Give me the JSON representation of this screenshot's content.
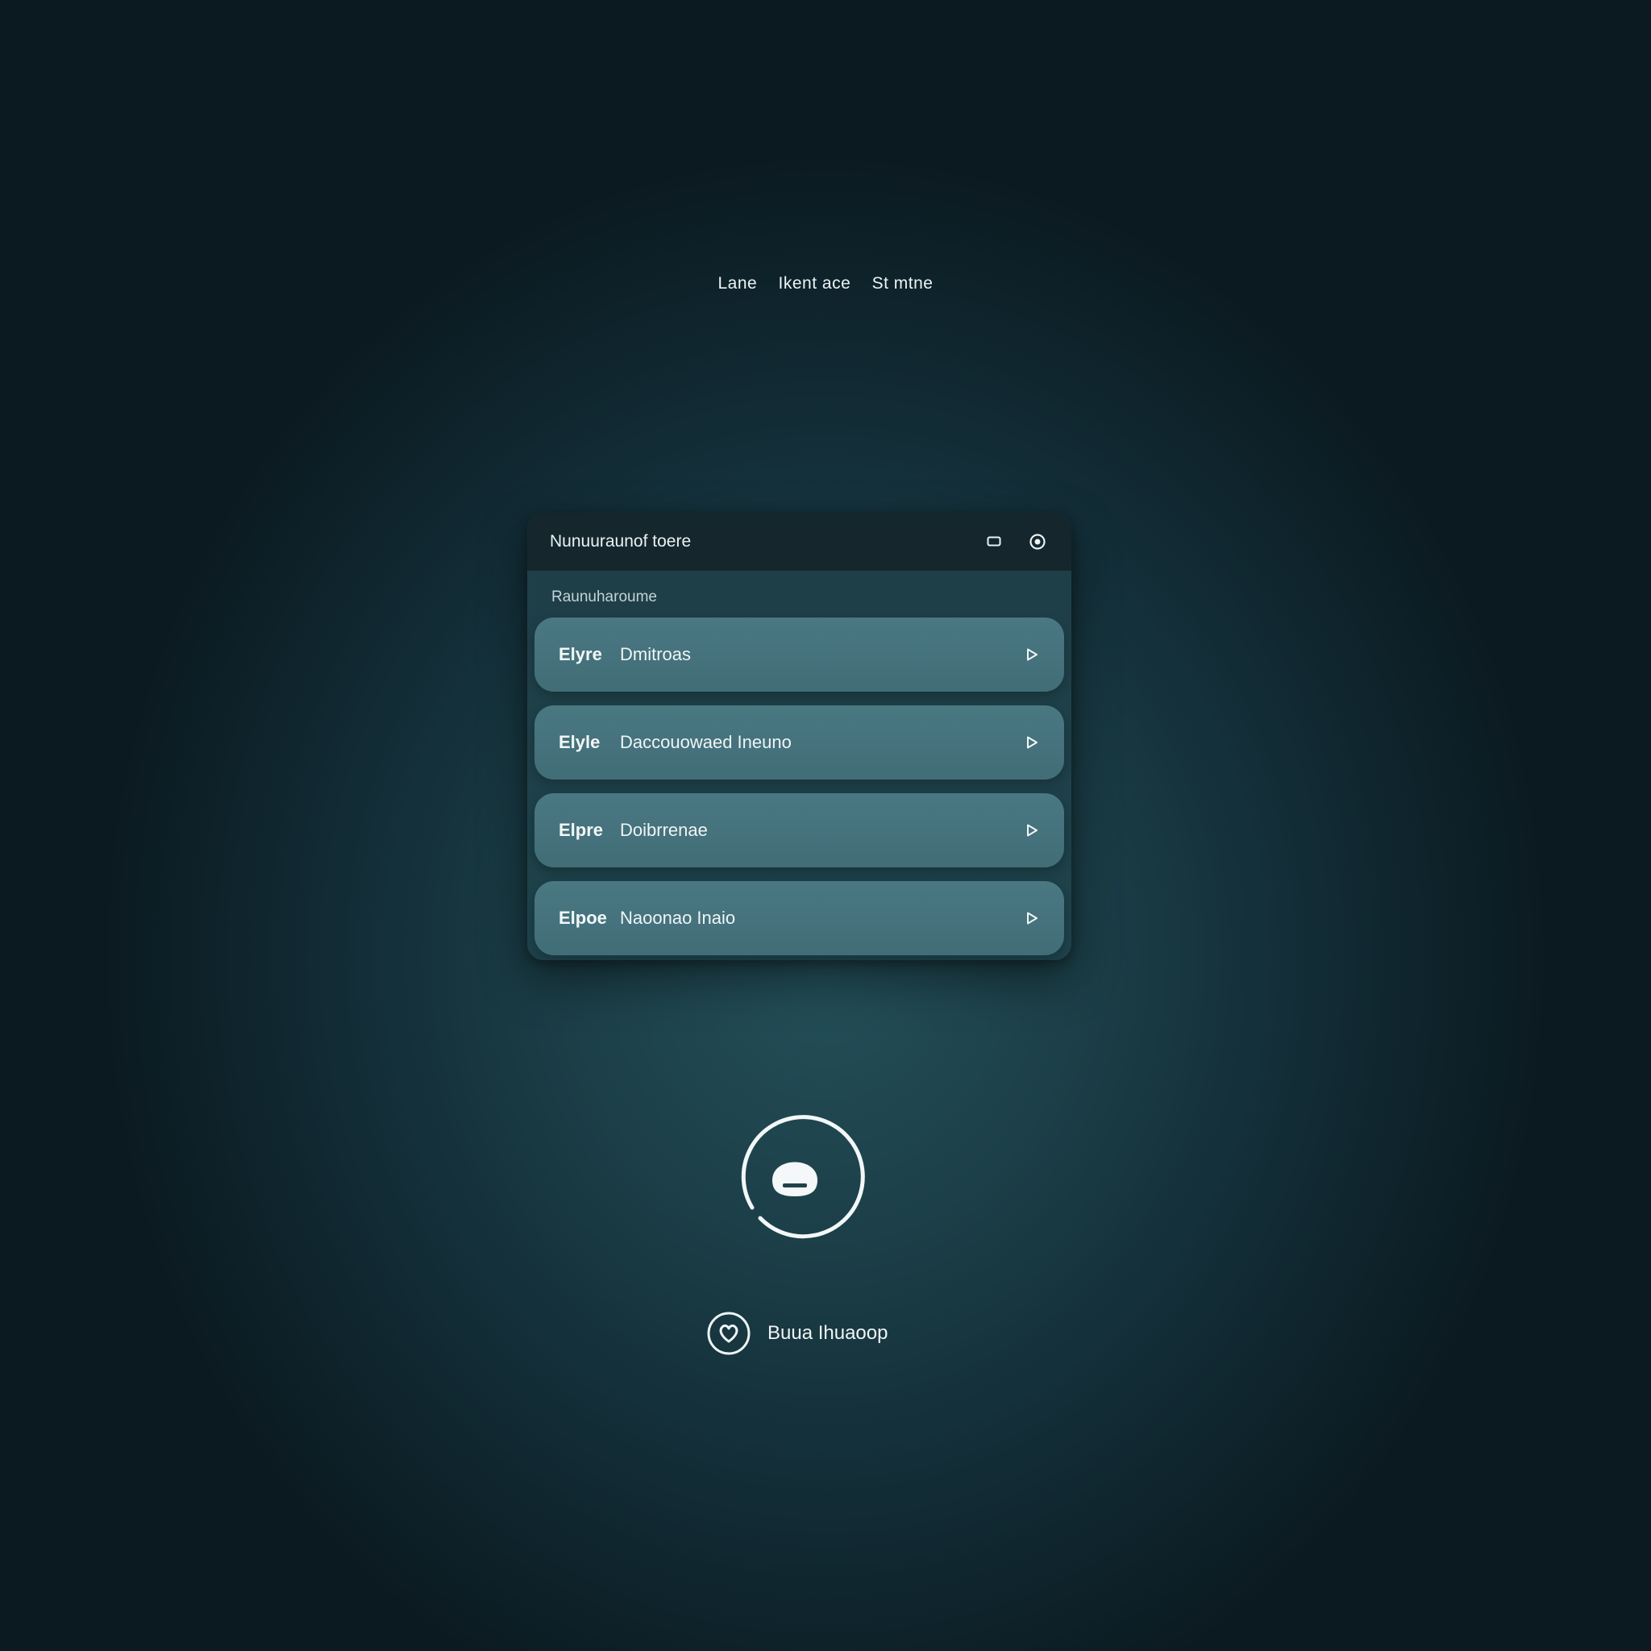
{
  "header": {
    "caption_parts": [
      "Lane",
      "Ikent ace",
      "St mtne"
    ]
  },
  "panel": {
    "title": "Nunuuraunof toere",
    "minimize_icon": "window-minimize-icon",
    "settings_icon": "settings-circle-icon",
    "section_label": "Raunuharoume",
    "items": [
      {
        "tag": "Elyre",
        "label": "Dmitroas",
        "icon": "play-arrow-icon"
      },
      {
        "tag": "Elyle",
        "label": "Daccouowaed Ineuno",
        "icon": "play-arrow-icon"
      },
      {
        "tag": "Elpre",
        "label": "Doibrrenae",
        "icon": "play-arrow-icon"
      },
      {
        "tag": "Elpoe",
        "label": "Naoonao Inaio",
        "icon": "play-arrow-icon"
      }
    ]
  },
  "record_button": {
    "icon": "microphone-record-icon"
  },
  "footer": {
    "icon": "heart-shield-icon",
    "label": "Buua Ihuaoop"
  },
  "colors": {
    "background_center": "#24505a",
    "background_edge": "#0b1a20",
    "panel_header": "#15272d",
    "list_item": "#4a7882",
    "text": "#eef4f5"
  }
}
